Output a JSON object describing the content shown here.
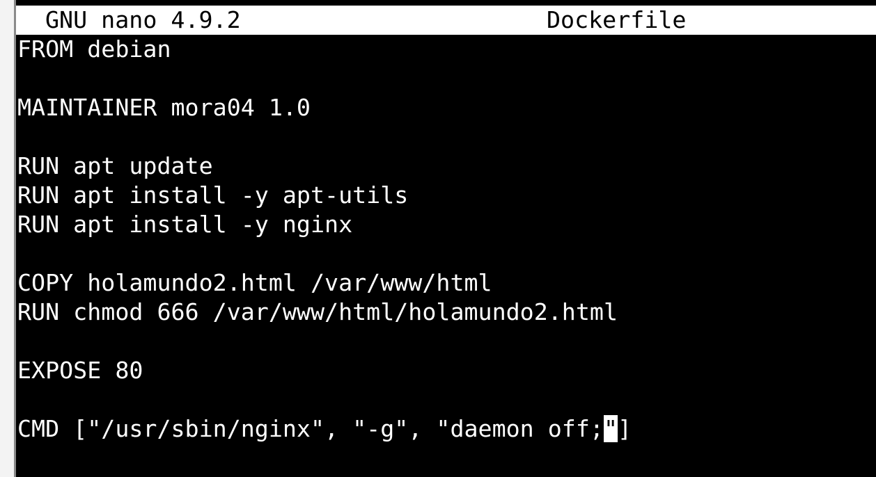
{
  "window": {
    "app_name": "GNU nano 4.9.2",
    "file_name": "Dockerfile"
  },
  "editor": {
    "lines": [
      "FROM debian",
      "",
      "MAINTAINER mora04 1.0",
      "",
      "RUN apt update",
      "RUN apt install -y apt-utils",
      "RUN apt install -y nginx",
      "",
      "COPY holamundo2.html /var/www/html",
      "RUN chmod 666 /var/www/html/holamundo2.html",
      "",
      "EXPOSE 80",
      "",
      "CMD [\"/usr/sbin/nginx\", \"-g\", \"daemon off;"
    ],
    "cursor_char": "\"",
    "after_cursor": "]"
  },
  "colors": {
    "background": "#000000",
    "text": "#ffffff",
    "title_bar": "#ffffff",
    "title_text": "#000000"
  }
}
